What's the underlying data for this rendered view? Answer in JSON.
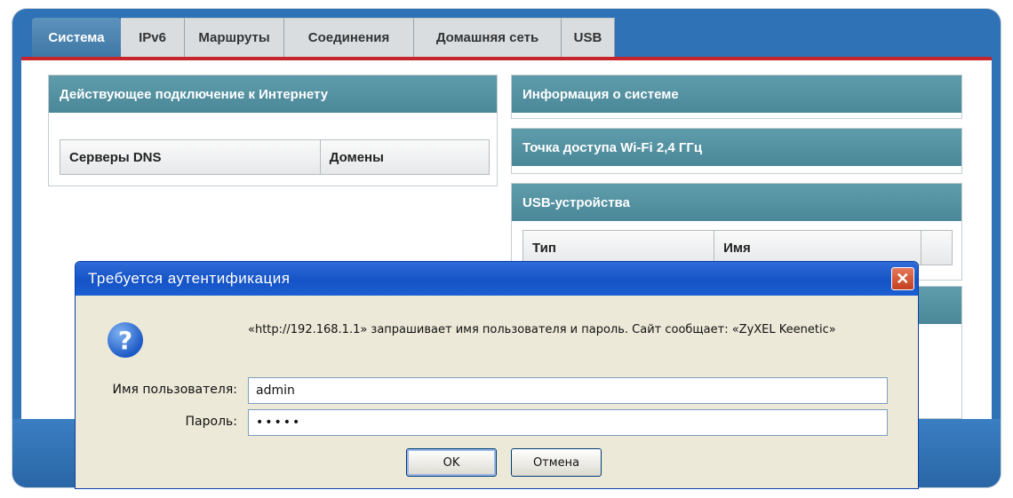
{
  "tabs": [
    "Система",
    "IPv6",
    "Маршруты",
    "Соединения",
    "Домашняя сеть",
    "USB"
  ],
  "left_panel": {
    "title": "Действующее подключение к Интернету",
    "columns": [
      "Серверы DNS",
      "Домены"
    ]
  },
  "right_panels": {
    "system_info": "Информация о системе",
    "wifi": "Точка доступа Wi-Fi 2,4 ГГц",
    "usb": {
      "title": "USB-устройства",
      "columns": [
        "Тип",
        "Имя",
        ""
      ]
    }
  },
  "dialog": {
    "title": "Требуется аутентификация",
    "message": "«http://192.168.1.1» запрашивает имя пользователя и пароль. Сайт сообщает: «ZyXEL Keenetic»",
    "username_label": "Имя пользователя:",
    "username_value": "admin",
    "password_label": "Пароль:",
    "password_value": "•••••",
    "ok_label": "OK",
    "cancel_label": "Отмена",
    "close_glyph": "✕",
    "question_glyph": "?"
  },
  "colors": {
    "frame": "#2f72b6",
    "accent_red": "#c8242b",
    "panel_header": "#4a8899",
    "dialog_title": "#1553c6"
  }
}
